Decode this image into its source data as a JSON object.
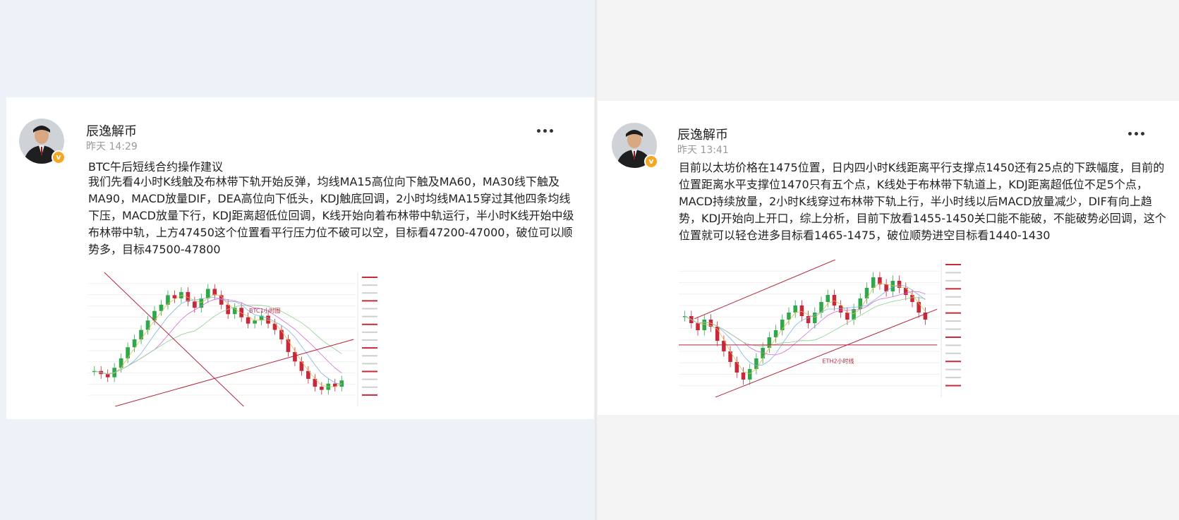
{
  "posts": [
    {
      "author": "辰逸解币",
      "time": "昨天 14:29",
      "title": "BTC午后短线合约操作建议",
      "body": "我们先看4小时K线触及布林带下轨开始反弹，均线MA15高位向下触及MA60，MA30线下触及MA90，MACD放量DIF，DEA高位向下低头，KDJ触底回调，2小时均线MA15穿过其他四条均线下压，MACD放量下行，KDJ距离超低位回调，K线开始向着布林带中轨运行，半小时K线开始中级布林带中轨，上方47450这个位置看平行压力位不破可以空，目标看47200-47000，破位可以顺势多，目标47500-47800",
      "chart_label": "BTC1小时图",
      "verified_icon": "verified-badge-icon"
    },
    {
      "author": "辰逸解币",
      "time": "昨天 13:41",
      "body": "目前以太坊价格在1475位置，日内四小时K线距离平行支撑点1450还有25点的下跌幅度，目前的位置距离水平支撑位1470只有五个点，K线处于布林带下轨道上，KDJ距离超低位不足5个点，MACD持续放量，2小时K线穿过布林带下轨上行，半小时线以后MACD放量减少，DIF有向上趋势，KDJ开始向上开口，综上分析，目前下放看1455-1450关口能不能破，不能破势必回调，这个位置就可以轻仓进多目标看1465-1475，破位顺势进空目标看1440-1430",
      "chart_label": "ETH2小时线",
      "verified_icon": "verified-badge-icon"
    }
  ],
  "colors": {
    "badge": "#f6a623",
    "trendline": "#b3263a",
    "candle_up": "#2ea84a",
    "candle_down": "#c8283a"
  }
}
